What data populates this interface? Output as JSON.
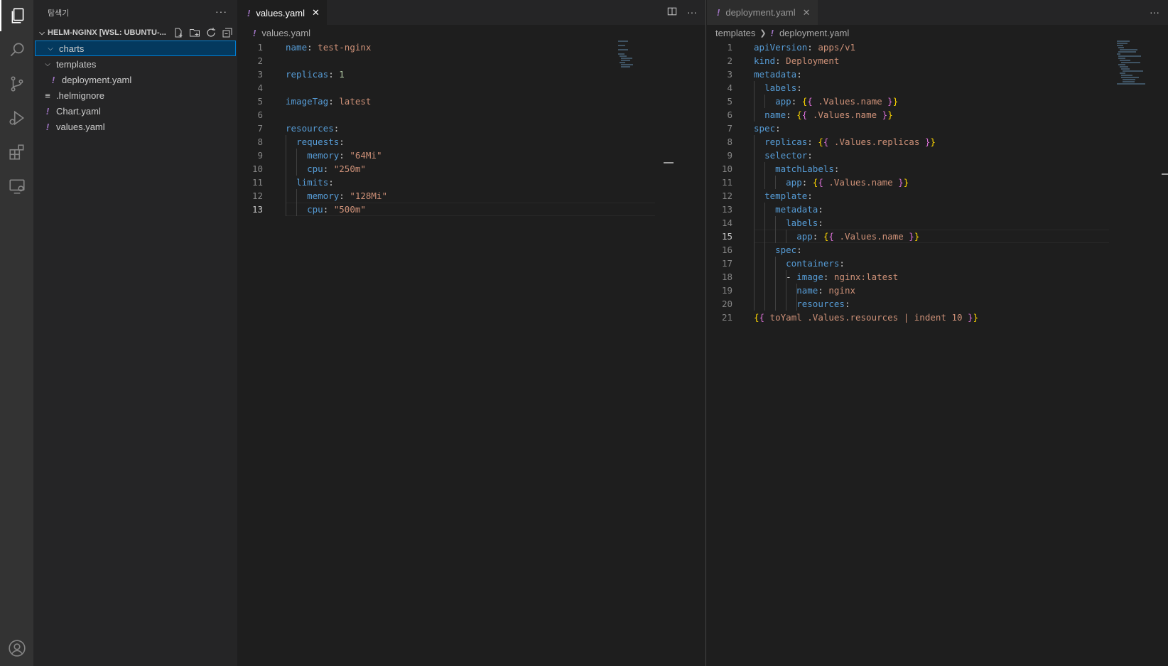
{
  "sidebar": {
    "title": "탐색기",
    "more": "···",
    "section_title": "HELM-NGINX [WSL: UBUNTU-...",
    "tree": [
      {
        "label": "charts",
        "kind": "folder",
        "depth": 0,
        "selected": true
      },
      {
        "label": "templates",
        "kind": "folder",
        "depth": 1
      },
      {
        "label": "deployment.yaml",
        "kind": "yaml",
        "depth": 2
      },
      {
        "label": ".helmignore",
        "kind": "text",
        "depth": 1
      },
      {
        "label": "Chart.yaml",
        "kind": "yaml",
        "depth": 1
      },
      {
        "label": "values.yaml",
        "kind": "yaml",
        "depth": 1
      }
    ]
  },
  "left_editor": {
    "tab_label": "values.yaml",
    "breadcrumb_file": "values.yaml",
    "current_line": "13"
  },
  "right_editor": {
    "tab_label": "deployment.yaml",
    "breadcrumb_folder": "templates",
    "breadcrumb_file": "deployment.yaml",
    "current_line": "15"
  },
  "left_lines": [
    {
      "n": "1",
      "t": "name: test-nginx"
    },
    {
      "n": "2",
      "t": ""
    },
    {
      "n": "3",
      "t": "replicas: 1"
    },
    {
      "n": "4",
      "t": ""
    },
    {
      "n": "5",
      "t": "imageTag: latest"
    },
    {
      "n": "6",
      "t": ""
    },
    {
      "n": "7",
      "t": "resources:"
    },
    {
      "n": "8",
      "t": "  requests:"
    },
    {
      "n": "9",
      "t": "    memory: \"64Mi\""
    },
    {
      "n": "10",
      "t": "    cpu: \"250m\""
    },
    {
      "n": "11",
      "t": "  limits:"
    },
    {
      "n": "12",
      "t": "    memory: \"128Mi\""
    },
    {
      "n": "13",
      "t": "    cpu: \"500m\""
    }
  ],
  "right_lines": [
    {
      "n": "1",
      "t": "apiVersion: apps/v1"
    },
    {
      "n": "2",
      "t": "kind: Deployment"
    },
    {
      "n": "3",
      "t": "metadata:"
    },
    {
      "n": "4",
      "t": "  labels:"
    },
    {
      "n": "5",
      "t": "    app: {{ .Values.name }}"
    },
    {
      "n": "6",
      "t": "  name: {{ .Values.name }}"
    },
    {
      "n": "7",
      "t": "spec:"
    },
    {
      "n": "8",
      "t": "  replicas: {{ .Values.replicas }}"
    },
    {
      "n": "9",
      "t": "  selector:"
    },
    {
      "n": "10",
      "t": "    matchLabels:"
    },
    {
      "n": "11",
      "t": "      app: {{ .Values.name }}"
    },
    {
      "n": "12",
      "t": "  template:"
    },
    {
      "n": "13",
      "t": "    metadata:"
    },
    {
      "n": "14",
      "t": "      labels:"
    },
    {
      "n": "15",
      "t": "        app: {{ .Values.name }}"
    },
    {
      "n": "16",
      "t": "    spec:"
    },
    {
      "n": "17",
      "t": "      containers:"
    },
    {
      "n": "18",
      "t": "      - image: nginx:latest"
    },
    {
      "n": "19",
      "t": "        name: nginx"
    },
    {
      "n": "20",
      "t": "        resources:"
    },
    {
      "n": "21",
      "t": "{{ toYaml .Values.resources | indent 10 }}"
    }
  ],
  "colors": {
    "key": "#569cd6",
    "string": "#ce9178",
    "number": "#b5cea8",
    "brace_outer": "#ffd700",
    "brace_inner": "#da70d6",
    "yaml_icon": "#a074c4",
    "selection": "#04395e"
  }
}
